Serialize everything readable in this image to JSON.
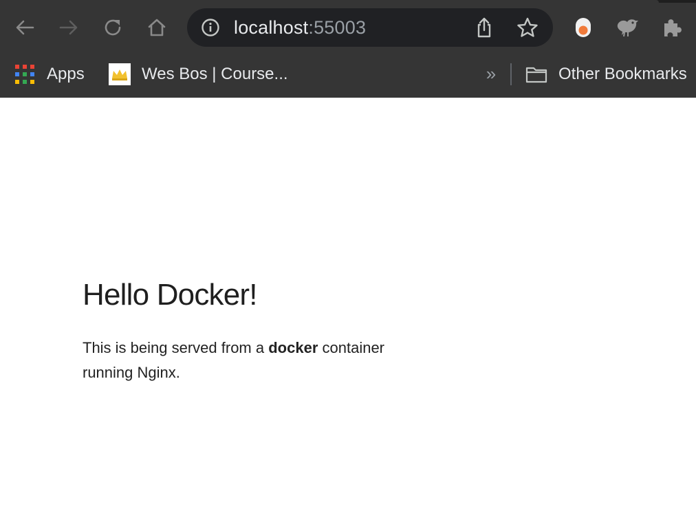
{
  "browser": {
    "address": {
      "host": "localhost",
      "port": ":55003"
    },
    "bookmarks": {
      "apps_label": "Apps",
      "item_1_label": "Wes Bos | Course...",
      "overflow_label": "»",
      "other_label": "Other Bookmarks"
    },
    "colors": {
      "chrome_bg": "#353535",
      "omnibox_bg": "#202124",
      "text": "#e8eaed",
      "muted": "#9aa0a6"
    }
  },
  "page": {
    "heading": "Hello Docker!",
    "para_prefix": "This is being served from a ",
    "para_bold": "docker",
    "para_suffix": " container running Nginx."
  }
}
